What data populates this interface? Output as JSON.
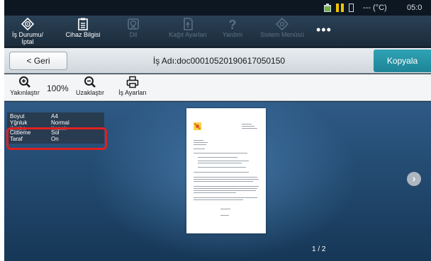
{
  "status_bar": {
    "temperature": "--- (°C)",
    "time": "05:0",
    "icons": [
      "toner-icon",
      "pause-icon",
      "memory-card-icon"
    ],
    "colors": {
      "pause": "#f2c500",
      "toner": "#6fb042"
    }
  },
  "toolbar": {
    "items": [
      {
        "label_1": "İş Durumu/",
        "label_2": "İptal",
        "icon": "job-status-icon",
        "enabled": true
      },
      {
        "label_1": "Cihaz Bilgisi",
        "label_2": "",
        "icon": "device-info-icon",
        "enabled": true
      },
      {
        "label_1": "Dil",
        "label_2": "",
        "icon": "language-icon",
        "enabled": false
      },
      {
        "label_1": "Kağıt Ayarları",
        "label_2": "",
        "icon": "paper-settings-icon",
        "enabled": false
      },
      {
        "label_1": "Yardım",
        "label_2": "",
        "icon": "help-icon",
        "enabled": false
      },
      {
        "label_1": "Sistem Menüsü",
        "label_2": "",
        "icon": "system-menu-icon",
        "enabled": false
      }
    ],
    "more": "•••"
  },
  "header": {
    "back_label": "< Geri",
    "job_name": "İş Adı:doc00010520190617050150",
    "copy_label": "Kopyala",
    "accent": "#1d8496"
  },
  "zoom": {
    "zoom_in_label": "Yakınlaştır",
    "zoom_level": "100%",
    "zoom_out_label": "Uzaklaştır",
    "job_settings_label": "İş Ayarları"
  },
  "info_panel": {
    "rows": [
      {
        "key": "Boyut",
        "value": "A4"
      },
      {
        "key": "Yğnluk",
        "value": "Normal"
      },
      {
        "key": "Zımba",
        "value": "Kapalı",
        "faded": true
      },
      {
        "key": "Cittleme",
        "value": "Sol"
      },
      {
        "key": "Taraf",
        "value": "On"
      }
    ],
    "highlight_color": "#e02020"
  },
  "preview": {
    "page_indicator": "1 / 2"
  }
}
